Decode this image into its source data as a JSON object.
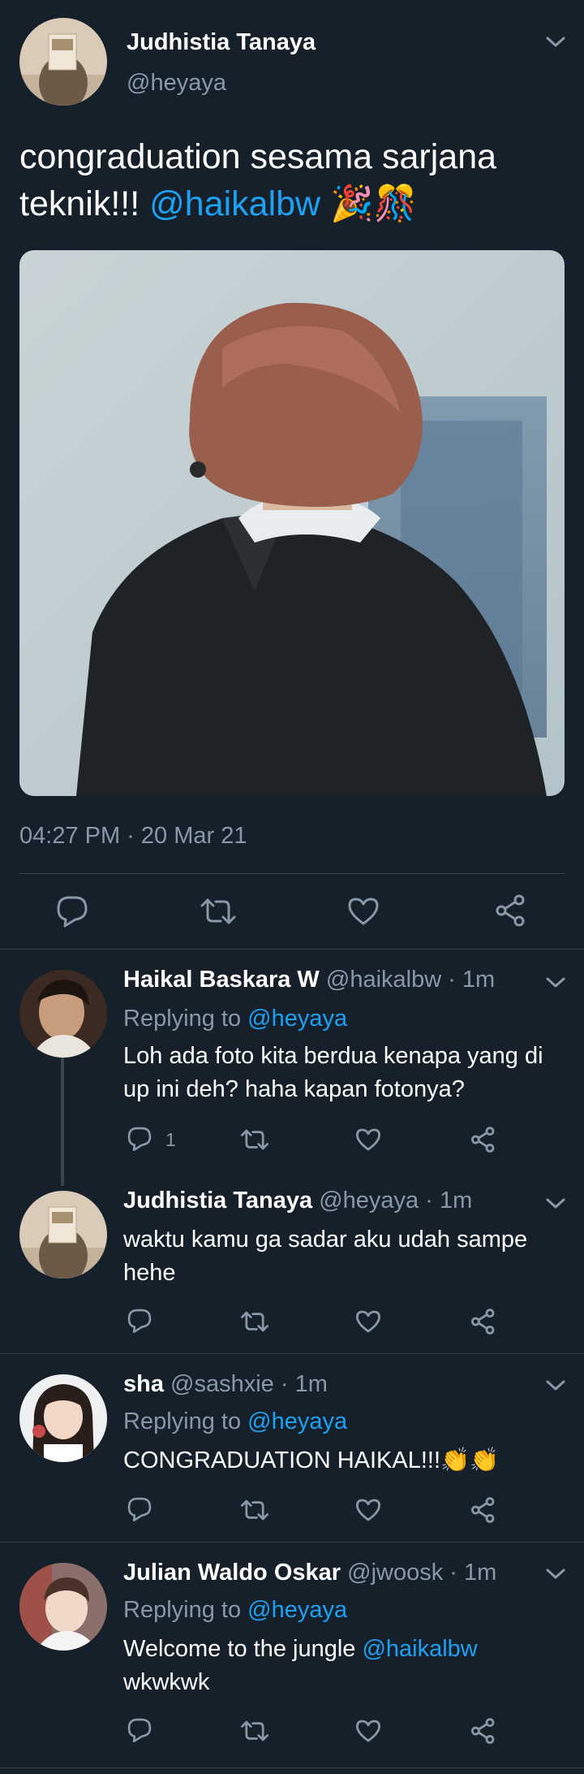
{
  "main_tweet": {
    "display_name": "Judhistia Tanaya",
    "handle": "@heyaya",
    "text": "congraduation sesama sarjana teknik!!! ",
    "mention": "@haikalbw",
    "emoji": "🎉🎊",
    "timestamp": "04:27 PM · 20 Mar 21"
  },
  "replies": [
    {
      "display_name": "Haikal Baskara W",
      "handle": "@haikalbw",
      "time": "· 1m",
      "replying_prefix": "Replying to ",
      "replying_handle": "@heyaya",
      "text": "Loh ada foto kita berdua kenapa yang di up ini deh? haha kapan fotonya?",
      "reply_count": "1"
    },
    {
      "display_name": "Judhistia Tanaya",
      "handle": "@heyaya",
      "time": "· 1m",
      "text": "waktu kamu ga sadar aku udah sampe hehe"
    },
    {
      "display_name": "sha",
      "handle": "@sashxie",
      "time": "· 1m",
      "replying_prefix": "Replying to ",
      "replying_handle": "@heyaya",
      "text": "CONGRADUATION HAIKAL!!!",
      "emoji": "👏👏"
    },
    {
      "display_name": "Julian Waldo Oskar",
      "handle": "@jwoosk",
      "time": "· 1m",
      "replying_prefix": "Replying to ",
      "replying_handle": "@heyaya",
      "text": "Welcome to the jungle ",
      "mention": "@haikalbw",
      "text_after": "wkwkwk"
    }
  ],
  "icons": [
    "chevron-down-icon",
    "reply-icon",
    "retweet-icon",
    "like-icon",
    "share-icon"
  ],
  "colors": {
    "background": "#15202b",
    "muted": "#8899a6",
    "link": "#1da1f2",
    "divider": "#38444d"
  }
}
